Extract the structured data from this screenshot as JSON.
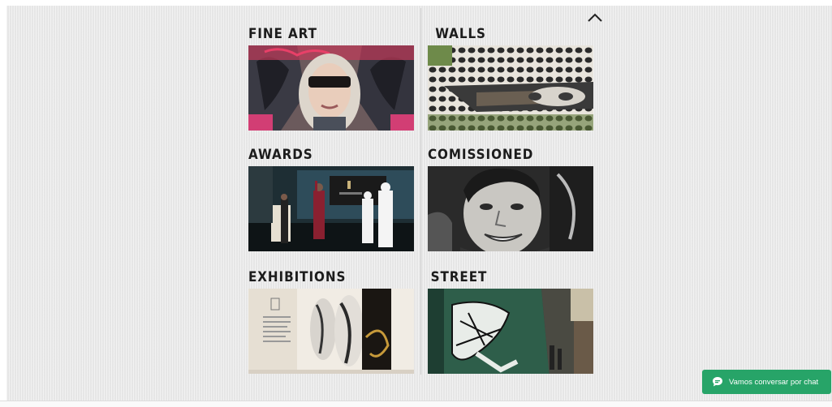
{
  "gallery": {
    "collapse_icon": "chevron-up-icon",
    "categories": [
      {
        "title": "FINE ART"
      },
      {
        "title": "WALLS"
      },
      {
        "title": "AWARDS"
      },
      {
        "title": "COMISSIONED"
      },
      {
        "title": "EXHIBITIONS"
      },
      {
        "title": "STREET"
      }
    ]
  },
  "chat": {
    "label": "Vamos conversar por chat",
    "icon": "chat-bubble-icon",
    "color": "#27a468"
  }
}
